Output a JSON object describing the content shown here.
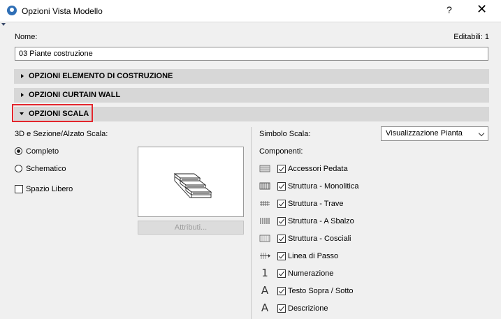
{
  "window": {
    "title": "Opzioni Vista Modello",
    "help_label": "?",
    "close_label": "✕"
  },
  "name": {
    "label": "Nome:",
    "editable_label": "Editabili: 1",
    "value": "03 Piante costruzione"
  },
  "sections": [
    {
      "label": "OPZIONI ELEMENTO DI COSTRUZIONE",
      "expanded": false
    },
    {
      "label": "OPZIONI CURTAIN WALL",
      "expanded": false
    },
    {
      "label": "OPZIONI SCALA",
      "expanded": true
    }
  ],
  "stair": {
    "view_label": "3D e Sezione/Alzato Scala:",
    "modes": [
      {
        "label": "Completo",
        "selected": true
      },
      {
        "label": "Schematico",
        "selected": false
      }
    ],
    "free_space": {
      "label": "Spazio Libero",
      "checked": false
    },
    "attributes_button": "Attributi...",
    "symbol_label": "Simbolo Scala:",
    "symbol_value": "Visualizzazione Pianta",
    "components_label": "Componenti:",
    "components": [
      {
        "label": "Accessori Pedata",
        "checked": true,
        "icon": "tread-accessories-icon"
      },
      {
        "label": "Struttura - Monolitica",
        "checked": true,
        "icon": "monolithic-structure-icon"
      },
      {
        "label": "Struttura - Trave",
        "checked": true,
        "icon": "beam-structure-icon"
      },
      {
        "label": "Struttura - A Sbalzo",
        "checked": true,
        "icon": "cantilever-structure-icon"
      },
      {
        "label": "Struttura - Cosciali",
        "checked": true,
        "icon": "stringer-structure-icon"
      },
      {
        "label": "Linea di Passo",
        "checked": true,
        "icon": "walking-line-icon"
      },
      {
        "label": "Numerazione",
        "checked": true,
        "icon": "numbering-icon"
      },
      {
        "label": "Testo Sopra / Sotto",
        "checked": true,
        "icon": "up-down-text-icon"
      },
      {
        "label": "Descrizione",
        "checked": true,
        "icon": "description-icon"
      }
    ]
  },
  "glyphs": {
    "numbering": "1",
    "text": "A"
  },
  "colors": {
    "highlight": "#e3262d",
    "section_bg": "#d7d7d7",
    "dialog_bg": "#f0f0f0"
  }
}
